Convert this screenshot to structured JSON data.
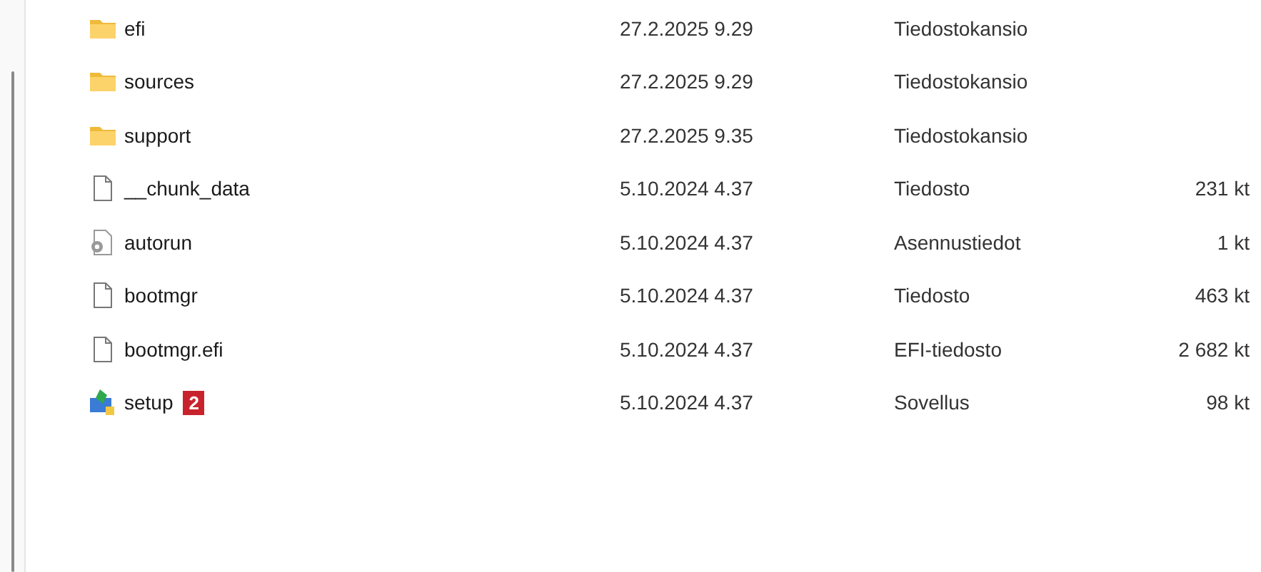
{
  "files": [
    {
      "kind": "folder",
      "name": "efi",
      "modified": "27.2.2025 9.29",
      "type": "Tiedostokansio"
    },
    {
      "kind": "folder",
      "name": "sources",
      "modified": "27.2.2025 9.29",
      "type": "Tiedostokansio"
    },
    {
      "kind": "folder",
      "name": "support",
      "modified": "27.2.2025 9.35",
      "type": "Tiedostokansio"
    },
    {
      "kind": "file",
      "name": "__chunk_data",
      "modified": "5.10.2024 4.37",
      "type": "Tiedosto",
      "size": "231 kt"
    },
    {
      "kind": "settings",
      "name": "autorun",
      "modified": "5.10.2024 4.37",
      "type": "Asennustiedot",
      "size": "1 kt"
    },
    {
      "kind": "file",
      "name": "bootmgr",
      "modified": "5.10.2024 4.37",
      "type": "Tiedosto",
      "size": "463 kt"
    },
    {
      "kind": "file",
      "name": "bootmgr.efi",
      "modified": "5.10.2024 4.37",
      "type": "EFI-tiedosto",
      "size": "2 682 kt"
    },
    {
      "kind": "app",
      "name": "setup",
      "badge": "2",
      "modified": "5.10.2024 4.37",
      "type": "Sovellus",
      "size": "98 kt"
    }
  ]
}
